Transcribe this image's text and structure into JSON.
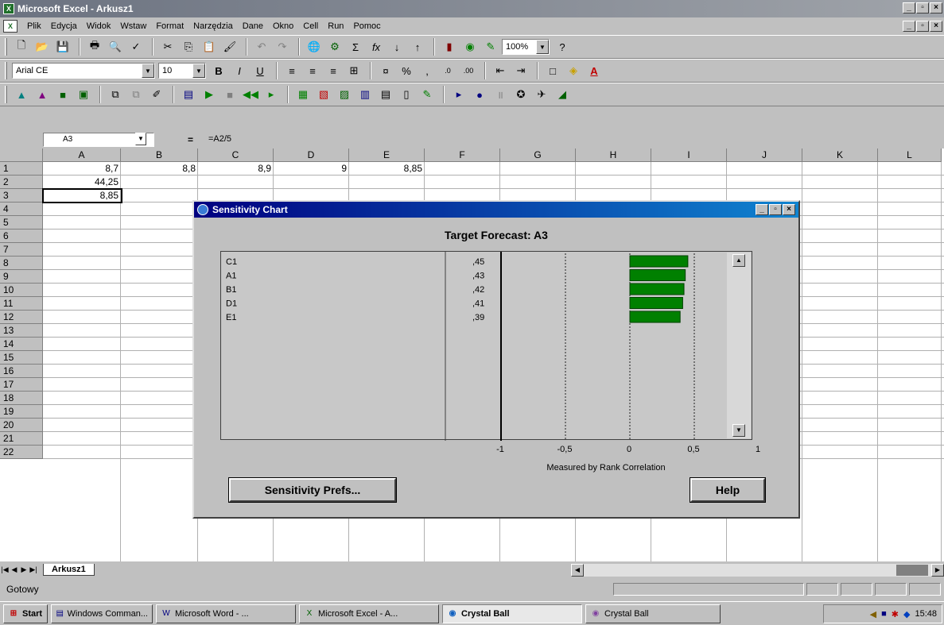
{
  "window": {
    "title": "Microsoft Excel - Arkusz1"
  },
  "menu": [
    "Plik",
    "Edycja",
    "Widok",
    "Wstaw",
    "Format",
    "Narzędzia",
    "Dane",
    "Okno",
    "Cell",
    "Run",
    "Pomoc"
  ],
  "toolbar": {
    "zoom": "100%",
    "font_name": "Arial CE",
    "font_size": "10"
  },
  "formula": {
    "name_box": "A3",
    "equals": "=",
    "content": "=A2/5"
  },
  "columns": [
    "A",
    "B",
    "C",
    "D",
    "E",
    "F",
    "G",
    "H",
    "I",
    "J",
    "K",
    "L"
  ],
  "rows": [
    "1",
    "2",
    "3",
    "4",
    "5",
    "6",
    "7",
    "8",
    "9",
    "10",
    "11",
    "12",
    "13",
    "14",
    "15",
    "16",
    "17",
    "18",
    "19",
    "20",
    "21",
    "22"
  ],
  "cells": {
    "A1": "8,7",
    "B1": "8,8",
    "C1": "8,9",
    "D1": "9",
    "E1": "8,85",
    "A2": "44,25",
    "A3": "8,85"
  },
  "sheet": {
    "tab": "Arkusz1",
    "status": "Gotowy"
  },
  "dialog": {
    "title": "Sensitivity Chart",
    "target_forecast": "Target Forecast:  A3",
    "axis_caption": "Measured by Rank Correlation",
    "x_ticks": [
      "-1",
      "-0,5",
      "0",
      "0,5",
      "1"
    ],
    "prefs_button": "Sensitivity Prefs...",
    "help_button": "Help"
  },
  "chart_data": {
    "type": "bar",
    "orientation": "horizontal",
    "title": "Target Forecast:  A3",
    "xlabel": "Measured by Rank Correlation",
    "xlim": [
      -1,
      1
    ],
    "categories": [
      "C1",
      "A1",
      "B1",
      "D1",
      "E1"
    ],
    "value_labels": [
      ",45",
      ",43",
      ",42",
      ",41",
      ",39"
    ],
    "values": [
      0.45,
      0.43,
      0.42,
      0.41,
      0.39
    ],
    "bar_color": "#008000"
  },
  "taskbar": {
    "start": "Start",
    "items": [
      "Windows Comman...",
      "Microsoft Word - ...",
      "Microsoft Excel - A...",
      "Crystal Ball",
      "Crystal Ball"
    ],
    "clock": "15:48"
  }
}
